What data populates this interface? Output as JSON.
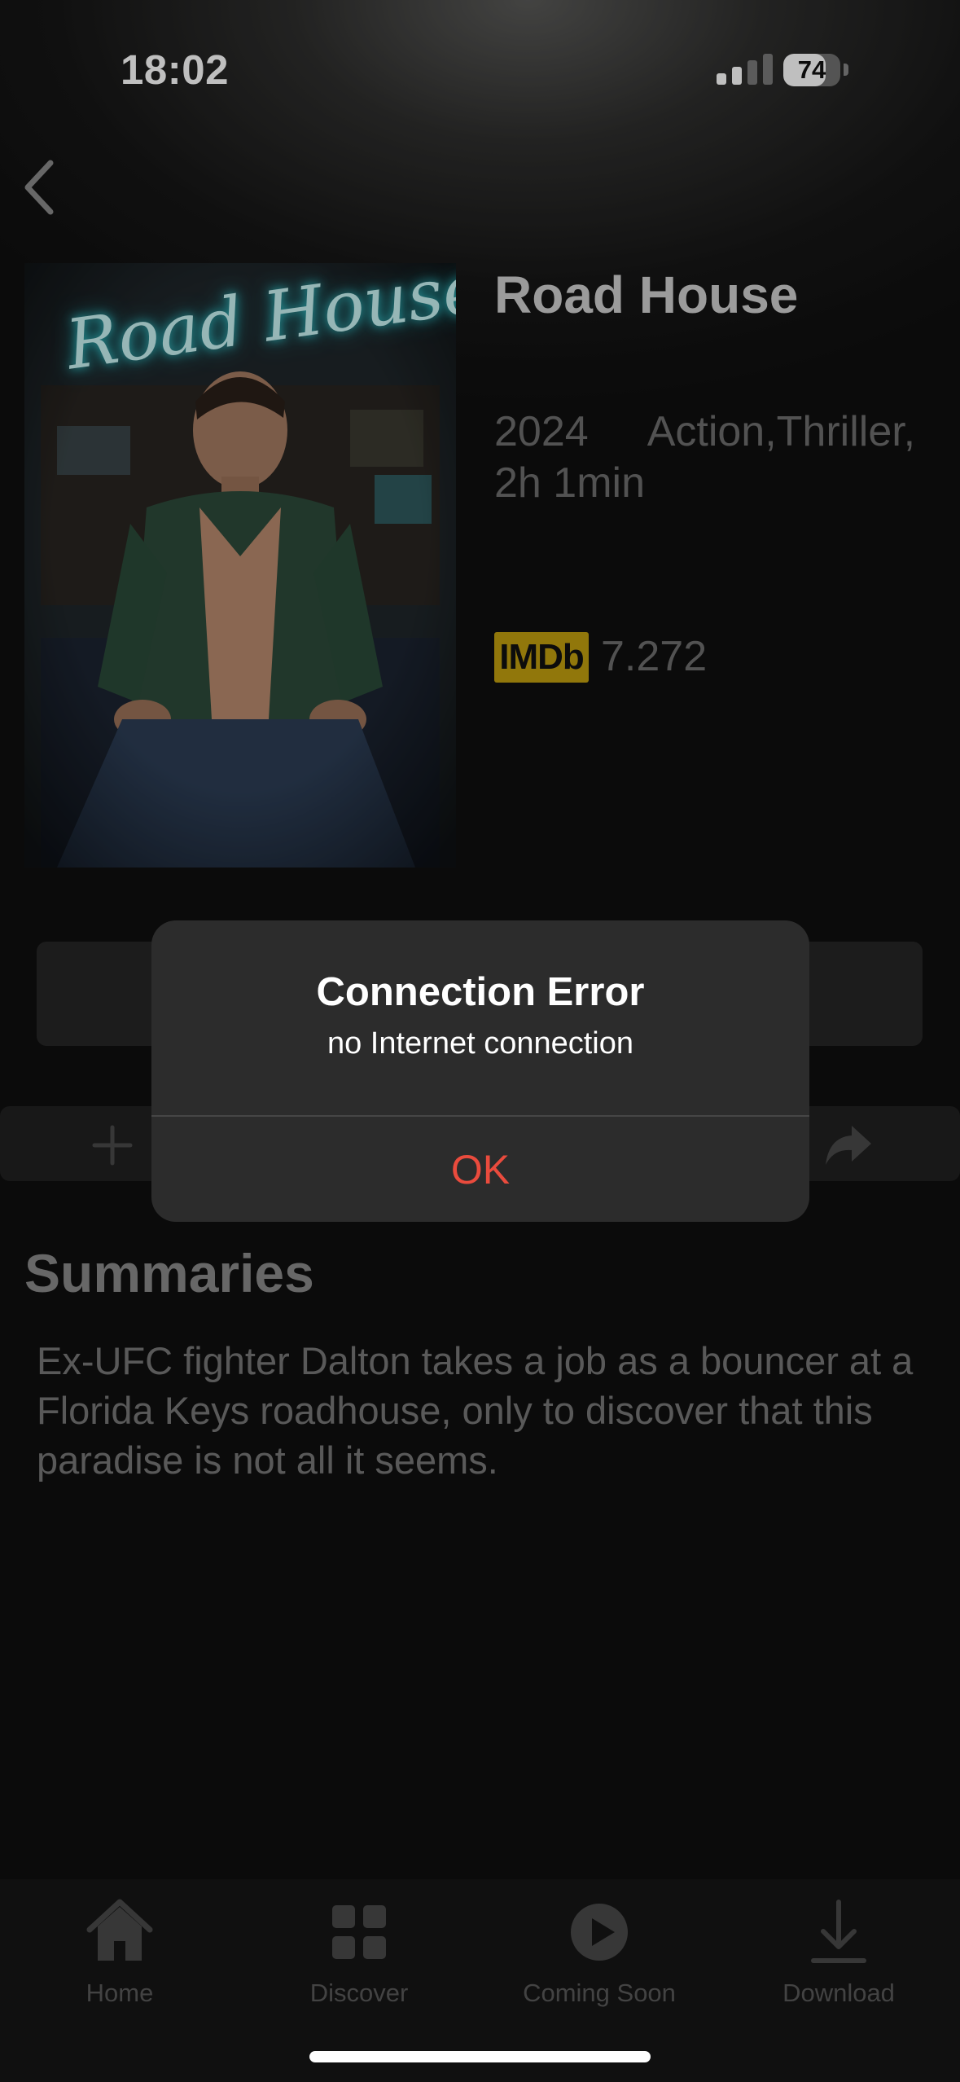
{
  "status_bar": {
    "time": "18:02",
    "battery": "74",
    "battery_level": 0.74
  },
  "movie": {
    "title": "Road House",
    "year": "2024",
    "genres": "Action,Thriller,",
    "duration": "2h 1min",
    "imdb_label": "IMDb",
    "imdb_rating": "7.272",
    "poster_title": "Road House"
  },
  "summary": {
    "heading": "Summaries",
    "text": "Ex-UFC fighter Dalton takes a job as a bouncer at a Florida Keys roadhouse, only to discover that this paradise is not all it seems."
  },
  "dialog": {
    "title": "Connection Error",
    "message": "no Internet connection",
    "ok_label": "OK"
  },
  "tab_bar": {
    "items": [
      {
        "label": "Home",
        "icon": "home-icon"
      },
      {
        "label": "Discover",
        "icon": "grid-icon"
      },
      {
        "label": "Coming Soon",
        "icon": "play-circle-icon"
      },
      {
        "label": "Download",
        "icon": "download-icon"
      }
    ]
  }
}
